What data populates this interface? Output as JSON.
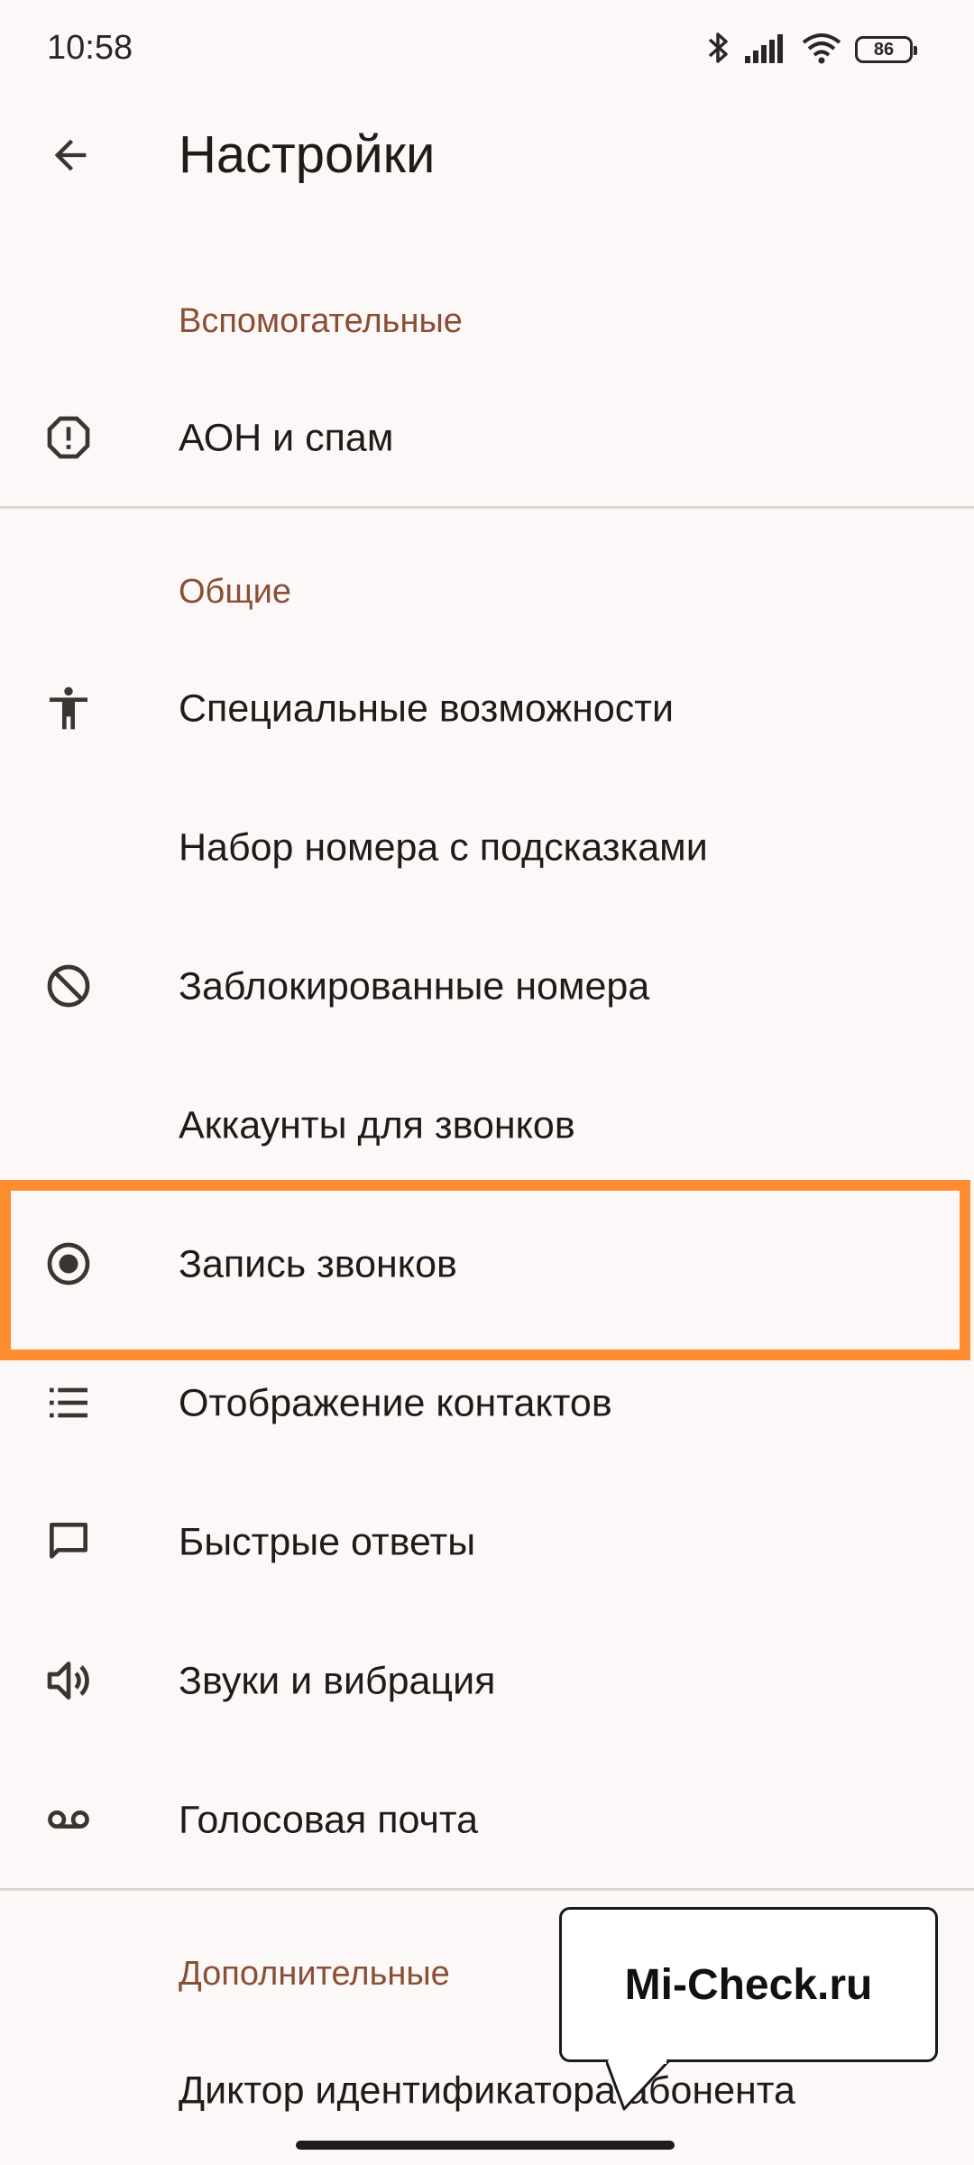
{
  "status_bar": {
    "time": "10:58",
    "battery": "86",
    "icons": [
      "bluetooth-icon",
      "signal-icon",
      "wifi-icon",
      "battery-icon"
    ]
  },
  "app_bar": {
    "title": "Настройки",
    "back_icon": "arrow-back-icon"
  },
  "sections": {
    "auxiliary": {
      "header": "Вспомогательные",
      "items": [
        {
          "label": "АОН и спам",
          "icon": "spam-alert-icon"
        }
      ]
    },
    "general": {
      "header": "Общие",
      "items": [
        {
          "label": "Специальные возможности",
          "icon": "accessibility-icon"
        },
        {
          "label": "Набор номера с подсказками",
          "icon": ""
        },
        {
          "label": "Заблокированные номера",
          "icon": "block-icon"
        },
        {
          "label": "Аккаунты для звонков",
          "icon": ""
        },
        {
          "label": "Запись звонков",
          "icon": "record-icon"
        },
        {
          "label": "Отображение контактов",
          "icon": "list-icon"
        },
        {
          "label": "Быстрые ответы",
          "icon": "message-icon"
        },
        {
          "label": "Звуки и вибрация",
          "icon": "volume-icon"
        },
        {
          "label": "Голосовая почта",
          "icon": "voicemail-icon"
        }
      ]
    },
    "additional": {
      "header": "Дополнительные",
      "items": [
        {
          "label": "Диктор идентификатора абонента",
          "icon": ""
        }
      ]
    }
  },
  "watermark": {
    "text": "Mi-Check.ru"
  },
  "colors": {
    "background": "#fdf8f8",
    "section_header": "#8a4f34",
    "highlight": "#ff8c2f",
    "text": "#201a19"
  }
}
